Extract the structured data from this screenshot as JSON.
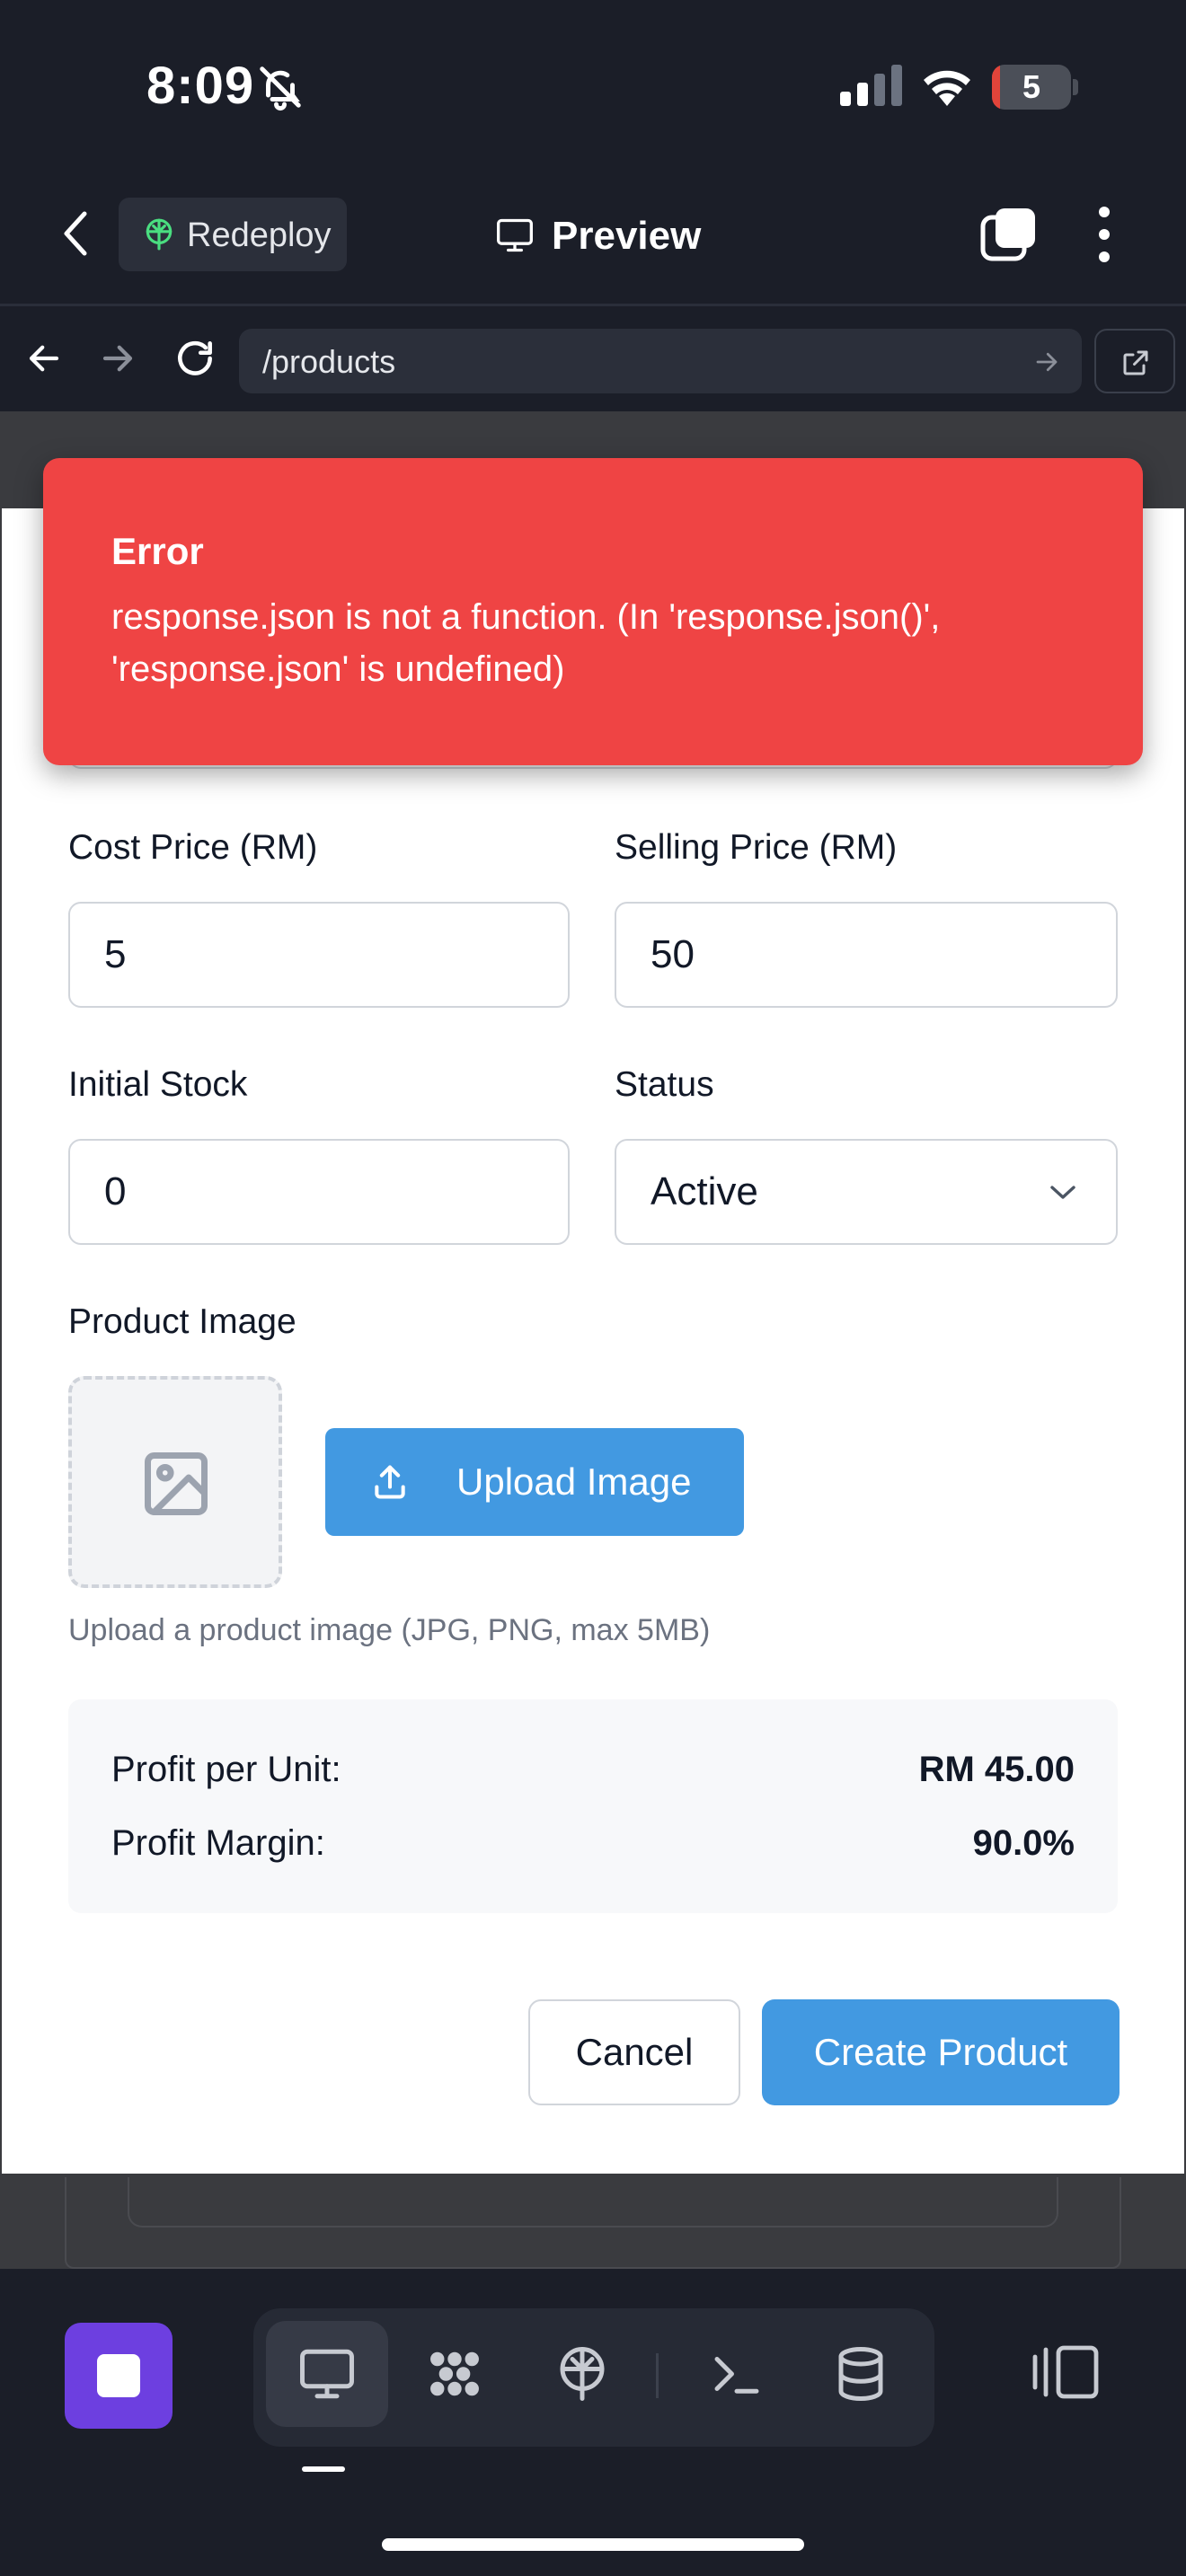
{
  "status_bar": {
    "time": "8:09",
    "battery_level": "5"
  },
  "header": {
    "redeploy_label": "Redeploy",
    "title": "Preview"
  },
  "browser": {
    "url": "/products"
  },
  "error_toast": {
    "title": "Error",
    "message": "response.json is not a function. (In 'response.json()', 'response.json' is undefined)"
  },
  "form": {
    "cost_price": {
      "label": "Cost Price (RM)",
      "value": "5"
    },
    "selling_price": {
      "label": "Selling Price (RM)",
      "value": "50"
    },
    "initial_stock": {
      "label": "Initial Stock",
      "value": "0"
    },
    "status": {
      "label": "Status",
      "value": "Active"
    },
    "product_image": {
      "label": "Product Image",
      "upload_label": "Upload Image",
      "help": "Upload a product image (JPG, PNG, max 5MB)"
    },
    "summary": {
      "profit_per_unit_label": "Profit per Unit:",
      "profit_per_unit_value": "RM 45.00",
      "profit_margin_label": "Profit Margin:",
      "profit_margin_value": "90.0%"
    },
    "actions": {
      "cancel_label": "Cancel",
      "create_label": "Create Product"
    }
  },
  "colors": {
    "error_bg": "#ef4444",
    "primary": "#4299e1",
    "stop_button": "#6d3fe0",
    "app_bg": "#1b1e28"
  },
  "toolbar": {
    "icons": [
      "stop-icon",
      "desktop-icon",
      "agents-icon",
      "deploy-icon",
      "terminal-icon",
      "database-icon",
      "panel-icon"
    ]
  }
}
